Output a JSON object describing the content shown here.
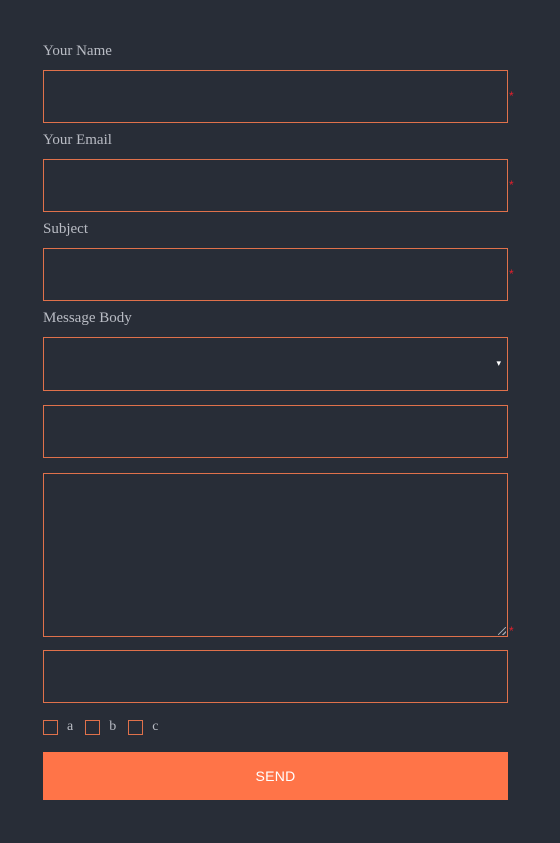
{
  "form": {
    "fields": {
      "name": {
        "label": "Your Name",
        "required_mark": "*"
      },
      "email": {
        "label": "Your Email",
        "required_mark": "*"
      },
      "subject": {
        "label": "Subject",
        "required_mark": "*"
      },
      "message": {
        "label": "Message Body",
        "dropdown_caret": "▾"
      },
      "textarea": {
        "required_mark": "*"
      }
    },
    "checkboxes": [
      {
        "label": "a",
        "checked": false
      },
      {
        "label": "b",
        "checked": false
      },
      {
        "label": "c",
        "checked": false
      }
    ],
    "send_label": "SEND"
  },
  "colors": {
    "background": "#282d37",
    "border_accent": "#e0714b",
    "button": "#ff7448",
    "required": "#e2202c",
    "label_text": "#b9bcc4"
  },
  "icons": {
    "dropdown": "chevron-down-icon",
    "resize": "resize-grip-icon"
  }
}
